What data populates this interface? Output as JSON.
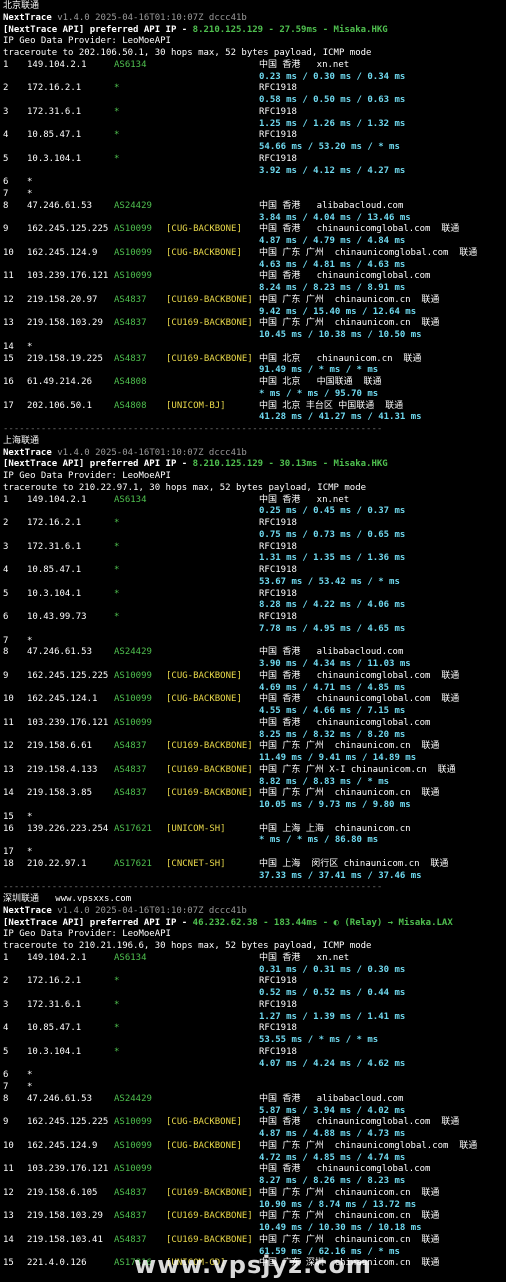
{
  "terminal": {
    "blocks": [
      {
        "title": "北京联通",
        "title_extra": "",
        "version": "v1.4.0 2025-04-16T01:10:07Z dccc41b",
        "api_prefix": "[NextTrace API] preferred API IP - ",
        "api_value": "8.210.125.129 - 27.59ms - Misaka.HKG",
        "geo_provider": "IP Geo Data Provider: LeoMoeAPI",
        "traceroute": "traceroute to 202.106.50.1, 30 hops max, 52 bytes payload, ICMP mode",
        "hops": [
          {
            "n": "1",
            "ip": "149.104.2.1",
            "as": "AS6134",
            "tag": "",
            "geo": "中国 香港   xn.net",
            "rtt": "0.23 ms / 0.30 ms / 0.34 ms"
          },
          {
            "n": "2",
            "ip": "172.16.2.1",
            "as": "*",
            "tag": "",
            "geo": "RFC1918",
            "rtt": "0.58 ms / 0.50 ms / 0.63 ms"
          },
          {
            "n": "3",
            "ip": "172.31.6.1",
            "as": "*",
            "tag": "",
            "geo": "RFC1918",
            "rtt": "1.25 ms / 1.26 ms / 1.32 ms"
          },
          {
            "n": "4",
            "ip": "10.85.47.1",
            "as": "*",
            "tag": "",
            "geo": "RFC1918",
            "rtt": "54.66 ms / 53.20 ms / * ms"
          },
          {
            "n": "5",
            "ip": "10.3.104.1",
            "as": "*",
            "tag": "",
            "geo": "RFC1918",
            "rtt": "3.92 ms / 4.12 ms / 4.27 ms"
          },
          {
            "n": "6",
            "ip": "*",
            "as": "",
            "tag": "",
            "geo": "",
            "rtt": ""
          },
          {
            "n": "7",
            "ip": "*",
            "as": "",
            "tag": "",
            "geo": "",
            "rtt": ""
          },
          {
            "n": "8",
            "ip": "47.246.61.53",
            "as": "AS24429",
            "tag": "",
            "geo": "中国 香港   alibabacloud.com",
            "rtt": "3.84 ms / 4.04 ms / 13.46 ms"
          },
          {
            "n": "9",
            "ip": "162.245.125.225",
            "as": "AS10099",
            "tag": "[CUG-BACKBONE]",
            "geo": "中国 香港   chinaunicomglobal.com  联通",
            "rtt": "4.87 ms / 4.79 ms / 4.84 ms"
          },
          {
            "n": "10",
            "ip": "162.245.124.9",
            "as": "AS10099",
            "tag": "[CUG-BACKBONE]",
            "geo": "中国 广东 广州  chinaunicomglobal.com  联通",
            "rtt": "4.63 ms / 4.81 ms / 4.63 ms"
          },
          {
            "n": "11",
            "ip": "103.239.176.121",
            "as": "AS10099",
            "tag": "",
            "geo": "中国 香港   chinaunicomglobal.com",
            "rtt": "8.24 ms / 8.23 ms / 8.91 ms"
          },
          {
            "n": "12",
            "ip": "219.158.20.97",
            "as": "AS4837",
            "tag": "[CU169-BACKBONE]",
            "geo": "中国 广东 广州  chinaunicom.cn  联通",
            "rtt": "9.42 ms / 15.40 ms / 12.64 ms"
          },
          {
            "n": "13",
            "ip": "219.158.103.29",
            "as": "AS4837",
            "tag": "[CU169-BACKBONE]",
            "geo": "中国 广东 广州  chinaunicom.cn  联通",
            "rtt": "10.45 ms / 10.38 ms / 10.50 ms"
          },
          {
            "n": "14",
            "ip": "*",
            "as": "",
            "tag": "",
            "geo": "",
            "rtt": ""
          },
          {
            "n": "15",
            "ip": "219.158.19.225",
            "as": "AS4837",
            "tag": "[CU169-BACKBONE]",
            "geo": "中国 北京   chinaunicom.cn  联通",
            "rtt": "91.49 ms / * ms / * ms"
          },
          {
            "n": "16",
            "ip": "61.49.214.26",
            "as": "AS4808",
            "tag": "",
            "geo": "中国 北京   中国联通  联通",
            "rtt": "* ms / * ms / 95.70 ms"
          },
          {
            "n": "17",
            "ip": "202.106.50.1",
            "as": "AS4808",
            "tag": "[UNICOM-BJ]",
            "geo": "中国 北京 丰台区 中国联通  联通",
            "rtt": "41.28 ms / 41.27 ms / 41.31 ms"
          }
        ]
      },
      {
        "title": "上海联通",
        "title_extra": "",
        "version": "v1.4.0 2025-04-16T01:10:07Z dccc41b",
        "api_prefix": "[NextTrace API] preferred API IP - ",
        "api_value": "8.210.125.129 - 30.13ms - Misaka.HKG",
        "geo_provider": "IP Geo Data Provider: LeoMoeAPI",
        "traceroute": "traceroute to 210.22.97.1, 30 hops max, 52 bytes payload, ICMP mode",
        "hops": [
          {
            "n": "1",
            "ip": "149.104.2.1",
            "as": "AS6134",
            "tag": "",
            "geo": "中国 香港   xn.net",
            "rtt": "0.25 ms / 0.45 ms / 0.37 ms"
          },
          {
            "n": "2",
            "ip": "172.16.2.1",
            "as": "*",
            "tag": "",
            "geo": "RFC1918",
            "rtt": "0.75 ms / 0.73 ms / 0.65 ms"
          },
          {
            "n": "3",
            "ip": "172.31.6.1",
            "as": "*",
            "tag": "",
            "geo": "RFC1918",
            "rtt": "1.31 ms / 1.35 ms / 1.36 ms"
          },
          {
            "n": "4",
            "ip": "10.85.47.1",
            "as": "*",
            "tag": "",
            "geo": "RFC1918",
            "rtt": "53.67 ms / 53.42 ms / * ms"
          },
          {
            "n": "5",
            "ip": "10.3.104.1",
            "as": "*",
            "tag": "",
            "geo": "RFC1918",
            "rtt": "8.28 ms / 4.22 ms / 4.06 ms"
          },
          {
            "n": "6",
            "ip": "10.43.99.73",
            "as": "*",
            "tag": "",
            "geo": "RFC1918",
            "rtt": "7.78 ms / 4.95 ms / 4.65 ms"
          },
          {
            "n": "7",
            "ip": "*",
            "as": "",
            "tag": "",
            "geo": "",
            "rtt": ""
          },
          {
            "n": "8",
            "ip": "47.246.61.53",
            "as": "AS24429",
            "tag": "",
            "geo": "中国 香港   alibabacloud.com",
            "rtt": "3.90 ms / 4.34 ms / 11.03 ms"
          },
          {
            "n": "9",
            "ip": "162.245.125.225",
            "as": "AS10099",
            "tag": "[CUG-BACKBONE]",
            "geo": "中国 香港   chinaunicomglobal.com  联通",
            "rtt": "4.69 ms / 4.71 ms / 4.85 ms"
          },
          {
            "n": "10",
            "ip": "162.245.124.1",
            "as": "AS10099",
            "tag": "[CUG-BACKBONE]",
            "geo": "中国 香港   chinaunicomglobal.com  联通",
            "rtt": "4.55 ms / 4.66 ms / 7.15 ms"
          },
          {
            "n": "11",
            "ip": "103.239.176.121",
            "as": "AS10099",
            "tag": "",
            "geo": "中国 香港   chinaunicomglobal.com",
            "rtt": "8.25 ms / 8.32 ms / 8.20 ms"
          },
          {
            "n": "12",
            "ip": "219.158.6.61",
            "as": "AS4837",
            "tag": "[CU169-BACKBONE]",
            "geo": "中国 广东 广州  chinaunicom.cn  联通",
            "rtt": "11.49 ms / 9.41 ms / 14.89 ms"
          },
          {
            "n": "13",
            "ip": "219.158.4.133",
            "as": "AS4837",
            "tag": "[CU169-BACKBONE]",
            "geo": "中国 广东 广州 X-I chinaunicom.cn  联通",
            "rtt": "8.82 ms / 8.83 ms / * ms"
          },
          {
            "n": "14",
            "ip": "219.158.3.85",
            "as": "AS4837",
            "tag": "[CU169-BACKBONE]",
            "geo": "中国 广东 广州  chinaunicom.cn  联通",
            "rtt": "10.05 ms / 9.73 ms / 9.80 ms"
          },
          {
            "n": "15",
            "ip": "*",
            "as": "",
            "tag": "",
            "geo": "",
            "rtt": ""
          },
          {
            "n": "16",
            "ip": "139.226.223.254",
            "as": "AS17621",
            "tag": "[UNICOM-SH]",
            "geo": "中国 上海 上海  chinaunicom.cn",
            "rtt": "* ms / * ms / 86.80 ms"
          },
          {
            "n": "17",
            "ip": "*",
            "as": "",
            "tag": "",
            "geo": "",
            "rtt": ""
          },
          {
            "n": "18",
            "ip": "210.22.97.1",
            "as": "AS17621",
            "tag": "[CNCNET-SH]",
            "geo": "中国 上海  闵行区 chinaunicom.cn  联通",
            "rtt": "37.33 ms / 37.41 ms / 37.46 ms"
          }
        ]
      },
      {
        "title": "深圳联通",
        "title_extra": "www.vpsxxs.com",
        "version": "v1.4.0 2025-04-16T01:10:07Z dccc41b",
        "api_prefix": "[NextTrace API] preferred API IP - ",
        "api_value": "46.232.62.38 - 183.44ms - ◐ (Relay) → Misaka.LAX",
        "geo_provider": "IP Geo Data Provider: LeoMoeAPI",
        "traceroute": "traceroute to 210.21.196.6, 30 hops max, 52 bytes payload, ICMP mode",
        "hops": [
          {
            "n": "1",
            "ip": "149.104.2.1",
            "as": "AS6134",
            "tag": "",
            "geo": "中国 香港   xn.net",
            "rtt": "0.31 ms / 0.31 ms / 0.30 ms"
          },
          {
            "n": "2",
            "ip": "172.16.2.1",
            "as": "*",
            "tag": "",
            "geo": "RFC1918",
            "rtt": "0.52 ms / 0.52 ms / 0.44 ms"
          },
          {
            "n": "3",
            "ip": "172.31.6.1",
            "as": "*",
            "tag": "",
            "geo": "RFC1918",
            "rtt": "1.27 ms / 1.39 ms / 1.41 ms"
          },
          {
            "n": "4",
            "ip": "10.85.47.1",
            "as": "*",
            "tag": "",
            "geo": "RFC1918",
            "rtt": "53.55 ms / * ms / * ms"
          },
          {
            "n": "5",
            "ip": "10.3.104.1",
            "as": "*",
            "tag": "",
            "geo": "RFC1918",
            "rtt": "4.07 ms / 4.24 ms / 4.62 ms"
          },
          {
            "n": "6",
            "ip": "*",
            "as": "",
            "tag": "",
            "geo": "",
            "rtt": ""
          },
          {
            "n": "7",
            "ip": "*",
            "as": "",
            "tag": "",
            "geo": "",
            "rtt": ""
          },
          {
            "n": "8",
            "ip": "47.246.61.53",
            "as": "AS24429",
            "tag": "",
            "geo": "中国 香港   alibabacloud.com",
            "rtt": "5.87 ms / 3.94 ms / 4.02 ms"
          },
          {
            "n": "9",
            "ip": "162.245.125.225",
            "as": "AS10099",
            "tag": "[CUG-BACKBONE]",
            "geo": "中国 香港   chinaunicomglobal.com  联通",
            "rtt": "4.87 ms / 4.88 ms / 4.73 ms"
          },
          {
            "n": "10",
            "ip": "162.245.124.9",
            "as": "AS10099",
            "tag": "[CUG-BACKBONE]",
            "geo": "中国 广东 广州  chinaunicomglobal.com  联通",
            "rtt": "4.72 ms / 4.85 ms / 4.74 ms"
          },
          {
            "n": "11",
            "ip": "103.239.176.121",
            "as": "AS10099",
            "tag": "",
            "geo": "中国 香港   chinaunicomglobal.com",
            "rtt": "8.27 ms / 8.26 ms / 8.23 ms"
          },
          {
            "n": "12",
            "ip": "219.158.6.105",
            "as": "AS4837",
            "tag": "[CU169-BACKBONE]",
            "geo": "中国 广东 广州  chinaunicom.cn  联通",
            "rtt": "10.90 ms / 8.74 ms / 13.72 ms"
          },
          {
            "n": "13",
            "ip": "219.158.103.29",
            "as": "AS4837",
            "tag": "[CU169-BACKBONE]",
            "geo": "中国 广东 广州  chinaunicom.cn  联通",
            "rtt": "10.49 ms / 10.30 ms / 10.18 ms"
          },
          {
            "n": "14",
            "ip": "219.158.103.41",
            "as": "AS4837",
            "tag": "[CU169-BACKBONE]",
            "geo": "中国 广东 广州  chinaunicom.cn  联通",
            "rtt": "61.59 ms / 62.16 ms / * ms"
          },
          {
            "n": "15",
            "ip": "221.4.0.126",
            "as": "AS17816",
            "tag": "[UNICOM-GD]",
            "geo": "中国 广东 深圳  chinaunicom.cn  联通",
            "rtt": ""
          }
        ]
      }
    ],
    "separator": "----------------------------------------------------------------------",
    "app_name": "NextTrace"
  },
  "watermark": "www.vpsjyz.com"
}
